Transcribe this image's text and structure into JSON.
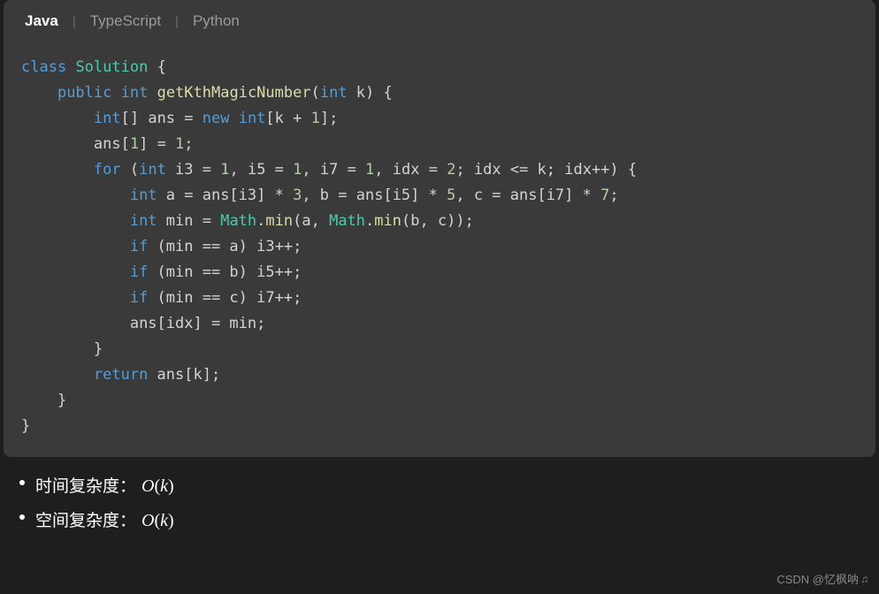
{
  "tabs": [
    {
      "label": "Java",
      "active": true
    },
    {
      "label": "TypeScript",
      "active": false
    },
    {
      "label": "Python",
      "active": false
    }
  ],
  "code": {
    "line1_class": "class",
    "line1_solution": "Solution",
    "line1_brace": " {",
    "line2_public": "public",
    "line2_int": "int",
    "line2_method": "getKthMagicNumber",
    "line2_paren_open": "(",
    "line2_param_type": "int",
    "line2_param_name": " k",
    "line2_paren_close": ")",
    "line2_brace": " {",
    "line3_int": "int",
    "line3_brackets": "[]",
    "line3_ans": " ans = ",
    "line3_new": "new",
    "line3_int2": " int",
    "line3_rest": "[k + ",
    "line3_num": "1",
    "line3_end": "];",
    "line4_text": "ans[",
    "line4_num1": "1",
    "line4_mid": "] = ",
    "line4_num2": "1",
    "line4_end": ";",
    "line5_for": "for",
    "line5_open": " (",
    "line5_int": "int",
    "line5_i3": " i3 = ",
    "line5_n1": "1",
    "line5_c1": ", i5 = ",
    "line5_n2": "1",
    "line5_c2": ", i7 = ",
    "line5_n3": "1",
    "line5_c3": ", idx = ",
    "line5_n4": "2",
    "line5_c4": "; idx <= k; idx++) {",
    "line6_int": "int",
    "line6_a": " a = ans[i3] * ",
    "line6_n1": "3",
    "line6_b": ", b = ans[i5] * ",
    "line6_n2": "5",
    "line6_c": ", c = ans[i7] * ",
    "line6_n3": "7",
    "line6_end": ";",
    "line7_int": "int",
    "line7_min": " min = ",
    "line7_math1": "Math",
    "line7_dot1": ".",
    "line7_minmethod1": "min",
    "line7_p1": "(a, ",
    "line7_math2": "Math",
    "line7_dot2": ".",
    "line7_minmethod2": "min",
    "line7_p2": "(b, c));",
    "line8_if": "if",
    "line8_rest": " (min == a) i3++;",
    "line9_if": "if",
    "line9_rest": " (min == b) i5++;",
    "line10_if": "if",
    "line10_rest": " (min == c) i7++;",
    "line11_text": "ans[idx] = min;",
    "line12_brace": "}",
    "line13_return": "return",
    "line13_rest": " ans[k];",
    "line14_brace": "}",
    "line15_brace": "}"
  },
  "complexity": {
    "time_label": "时间复杂度：",
    "time_formula_o": "O",
    "time_formula_open": "(",
    "time_formula_var": "k",
    "time_formula_close": ")",
    "space_label": "空间复杂度：",
    "space_formula_o": "O",
    "space_formula_open": "(",
    "space_formula_var": "k",
    "space_formula_close": ")"
  },
  "watermark": {
    "text": "CSDN @忆枫呐",
    "note": "♫"
  }
}
